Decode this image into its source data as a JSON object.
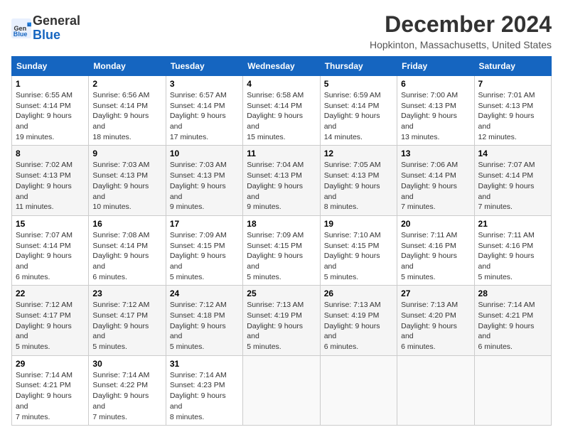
{
  "header": {
    "logo_general": "General",
    "logo_blue": "Blue",
    "month_title": "December 2024",
    "location": "Hopkinton, Massachusetts, United States"
  },
  "days_of_week": [
    "Sunday",
    "Monday",
    "Tuesday",
    "Wednesday",
    "Thursday",
    "Friday",
    "Saturday"
  ],
  "weeks": [
    [
      {
        "day": "1",
        "sunrise": "6:55 AM",
        "sunset": "4:14 PM",
        "daylight": "9 hours and 19 minutes."
      },
      {
        "day": "2",
        "sunrise": "6:56 AM",
        "sunset": "4:14 PM",
        "daylight": "9 hours and 18 minutes."
      },
      {
        "day": "3",
        "sunrise": "6:57 AM",
        "sunset": "4:14 PM",
        "daylight": "9 hours and 17 minutes."
      },
      {
        "day": "4",
        "sunrise": "6:58 AM",
        "sunset": "4:14 PM",
        "daylight": "9 hours and 15 minutes."
      },
      {
        "day": "5",
        "sunrise": "6:59 AM",
        "sunset": "4:14 PM",
        "daylight": "9 hours and 14 minutes."
      },
      {
        "day": "6",
        "sunrise": "7:00 AM",
        "sunset": "4:13 PM",
        "daylight": "9 hours and 13 minutes."
      },
      {
        "day": "7",
        "sunrise": "7:01 AM",
        "sunset": "4:13 PM",
        "daylight": "9 hours and 12 minutes."
      }
    ],
    [
      {
        "day": "8",
        "sunrise": "7:02 AM",
        "sunset": "4:13 PM",
        "daylight": "9 hours and 11 minutes."
      },
      {
        "day": "9",
        "sunrise": "7:03 AM",
        "sunset": "4:13 PM",
        "daylight": "9 hours and 10 minutes."
      },
      {
        "day": "10",
        "sunrise": "7:03 AM",
        "sunset": "4:13 PM",
        "daylight": "9 hours and 9 minutes."
      },
      {
        "day": "11",
        "sunrise": "7:04 AM",
        "sunset": "4:13 PM",
        "daylight": "9 hours and 9 minutes."
      },
      {
        "day": "12",
        "sunrise": "7:05 AM",
        "sunset": "4:13 PM",
        "daylight": "9 hours and 8 minutes."
      },
      {
        "day": "13",
        "sunrise": "7:06 AM",
        "sunset": "4:14 PM",
        "daylight": "9 hours and 7 minutes."
      },
      {
        "day": "14",
        "sunrise": "7:07 AM",
        "sunset": "4:14 PM",
        "daylight": "9 hours and 7 minutes."
      }
    ],
    [
      {
        "day": "15",
        "sunrise": "7:07 AM",
        "sunset": "4:14 PM",
        "daylight": "9 hours and 6 minutes."
      },
      {
        "day": "16",
        "sunrise": "7:08 AM",
        "sunset": "4:14 PM",
        "daylight": "9 hours and 6 minutes."
      },
      {
        "day": "17",
        "sunrise": "7:09 AM",
        "sunset": "4:15 PM",
        "daylight": "9 hours and 5 minutes."
      },
      {
        "day": "18",
        "sunrise": "7:09 AM",
        "sunset": "4:15 PM",
        "daylight": "9 hours and 5 minutes."
      },
      {
        "day": "19",
        "sunrise": "7:10 AM",
        "sunset": "4:15 PM",
        "daylight": "9 hours and 5 minutes."
      },
      {
        "day": "20",
        "sunrise": "7:11 AM",
        "sunset": "4:16 PM",
        "daylight": "9 hours and 5 minutes."
      },
      {
        "day": "21",
        "sunrise": "7:11 AM",
        "sunset": "4:16 PM",
        "daylight": "9 hours and 5 minutes."
      }
    ],
    [
      {
        "day": "22",
        "sunrise": "7:12 AM",
        "sunset": "4:17 PM",
        "daylight": "9 hours and 5 minutes."
      },
      {
        "day": "23",
        "sunrise": "7:12 AM",
        "sunset": "4:17 PM",
        "daylight": "9 hours and 5 minutes."
      },
      {
        "day": "24",
        "sunrise": "7:12 AM",
        "sunset": "4:18 PM",
        "daylight": "9 hours and 5 minutes."
      },
      {
        "day": "25",
        "sunrise": "7:13 AM",
        "sunset": "4:19 PM",
        "daylight": "9 hours and 5 minutes."
      },
      {
        "day": "26",
        "sunrise": "7:13 AM",
        "sunset": "4:19 PM",
        "daylight": "9 hours and 6 minutes."
      },
      {
        "day": "27",
        "sunrise": "7:13 AM",
        "sunset": "4:20 PM",
        "daylight": "9 hours and 6 minutes."
      },
      {
        "day": "28",
        "sunrise": "7:14 AM",
        "sunset": "4:21 PM",
        "daylight": "9 hours and 6 minutes."
      }
    ],
    [
      {
        "day": "29",
        "sunrise": "7:14 AM",
        "sunset": "4:21 PM",
        "daylight": "9 hours and 7 minutes."
      },
      {
        "day": "30",
        "sunrise": "7:14 AM",
        "sunset": "4:22 PM",
        "daylight": "9 hours and 7 minutes."
      },
      {
        "day": "31",
        "sunrise": "7:14 AM",
        "sunset": "4:23 PM",
        "daylight": "9 hours and 8 minutes."
      },
      null,
      null,
      null,
      null
    ]
  ],
  "labels": {
    "sunrise": "Sunrise:",
    "sunset": "Sunset:",
    "daylight": "Daylight:"
  }
}
